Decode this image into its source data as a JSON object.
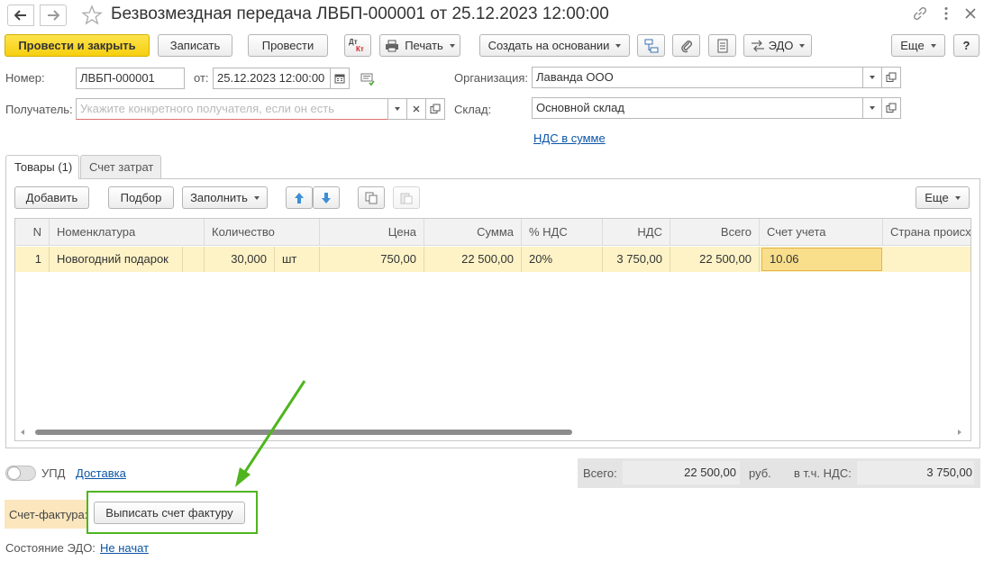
{
  "window": {
    "title": "Безвозмездная передача ЛВБП-000001 от 25.12.2023 12:00:00"
  },
  "toolbar": {
    "post_close": "Провести и закрыть",
    "save": "Записать",
    "post": "Провести",
    "dtkt_top": "Дт",
    "dtkt_bottom": "Кт",
    "print": "Печать",
    "create_based": "Создать на основании",
    "edo": "ЭДО",
    "more": "Еще",
    "help": "?"
  },
  "form": {
    "number_label": "Номер:",
    "number_value": "ЛВБП-000001",
    "date_label": "от:",
    "date_value": "25.12.2023 12:00:00",
    "org_label": "Организация:",
    "org_value": "Лаванда ООО",
    "recipient_label": "Получатель:",
    "recipient_placeholder": "Укажите конкретного получателя, если он есть",
    "warehouse_label": "Склад:",
    "warehouse_value": "Основной склад",
    "vat_link": "НДС в сумме"
  },
  "tabs": [
    {
      "label": "Товары (1)",
      "active": true
    },
    {
      "label": "Счет затрат",
      "active": false
    }
  ],
  "table_toolbar": {
    "add": "Добавить",
    "pick": "Подбор",
    "fill": "Заполнить",
    "more": "Еще"
  },
  "table": {
    "columns": [
      "N",
      "Номенклатура",
      "Количество",
      "Цена",
      "Сумма",
      "% НДС",
      "НДС",
      "Всего",
      "Счет учета",
      "Страна происх"
    ],
    "rows": [
      {
        "n": "1",
        "item": "Новогодний подарок",
        "qty": "30,000",
        "unit": "шт",
        "price": "750,00",
        "sum": "22 500,00",
        "vat_rate": "20%",
        "vat": "3 750,00",
        "total": "22 500,00",
        "account": "10.06",
        "country": ""
      }
    ]
  },
  "footer": {
    "upd_label": "УПД",
    "delivery_link": "Доставка",
    "total_label": "Всего:",
    "total_value": "22 500,00",
    "currency": "руб.",
    "vat_label": "в т.ч. НДС:",
    "vat_value": "3 750,00",
    "invoice_label": "Счет-фактура:",
    "invoice_button": "Выписать счет фактуру",
    "edo_state_label": "Состояние ЭДО:",
    "edo_state_link": "Не начат"
  },
  "colors": {
    "accent_button": "#f5cf0f",
    "selected_row": "#fdf3c7",
    "selected_cell": "#f9df8c",
    "link": "#0c55a6",
    "highlight_box": "#4fb51f",
    "invoice_panel": "#fbe6bd"
  }
}
